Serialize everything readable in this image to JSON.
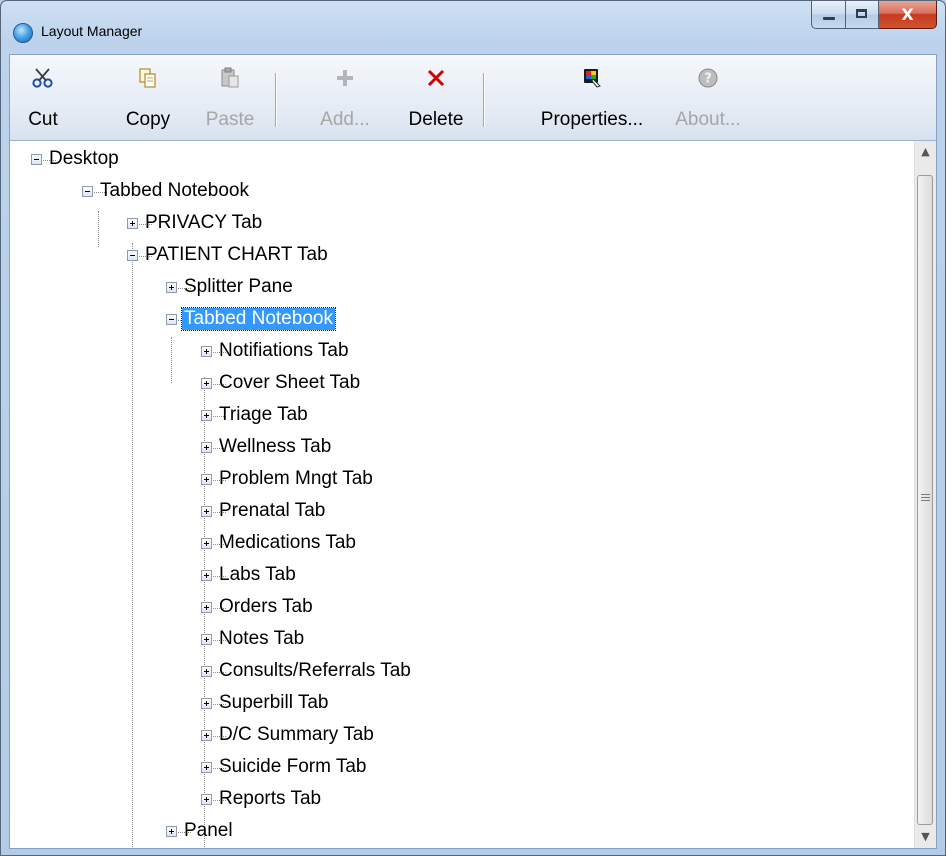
{
  "window": {
    "title": "Layout Manager",
    "caption_buttons": {
      "minimize": "minimize",
      "maximize": "maximize",
      "close": "X"
    }
  },
  "toolbar": {
    "cut": {
      "label": "Cut",
      "icon": "scissors-icon",
      "enabled": true
    },
    "copy": {
      "label": "Copy",
      "icon": "copy-icon",
      "enabled": true
    },
    "paste": {
      "label": "Paste",
      "icon": "paste-icon",
      "enabled": false
    },
    "add": {
      "label": "Add...",
      "icon": "plus-icon",
      "enabled": false
    },
    "delete": {
      "label": "Delete",
      "icon": "delete-x-icon",
      "enabled": true
    },
    "properties": {
      "label": "Properties...",
      "icon": "properties-icon",
      "enabled": true
    },
    "about": {
      "label": "About...",
      "icon": "help-icon",
      "enabled": false
    }
  },
  "tree": {
    "root": {
      "label": "Desktop",
      "expanded": true
    },
    "notebook": {
      "label": "Tabbed Notebook",
      "expanded": true
    },
    "privacy_tab": {
      "label": "PRIVACY Tab",
      "expanded": false
    },
    "patient_chart_tab": {
      "label": "PATIENT CHART Tab",
      "expanded": true
    },
    "splitter_pane": {
      "label": "Splitter Pane",
      "expanded": false
    },
    "inner_notebook": {
      "label": "Tabbed Notebook",
      "expanded": true,
      "selected": true
    },
    "tabs": [
      {
        "label": "Notifiations Tab"
      },
      {
        "label": "Cover Sheet Tab"
      },
      {
        "label": "Triage Tab"
      },
      {
        "label": "Wellness Tab"
      },
      {
        "label": "Problem Mngt Tab"
      },
      {
        "label": "Prenatal Tab"
      },
      {
        "label": "Medications Tab"
      },
      {
        "label": "Labs Tab"
      },
      {
        "label": "Orders Tab"
      },
      {
        "label": "Notes Tab"
      },
      {
        "label": "Consults/Referrals Tab"
      },
      {
        "label": "Superbill Tab"
      },
      {
        "label": "D/C Summary Tab"
      },
      {
        "label": "Suicide Form Tab"
      },
      {
        "label": "Reports Tab"
      }
    ],
    "panel": {
      "label": "Panel",
      "expanded": false
    }
  },
  "colors": {
    "selection": "#3399ff",
    "delete_icon": "#d40000",
    "add_icon": "#b5b5b5",
    "disabled_text": "#a6a6a6"
  }
}
